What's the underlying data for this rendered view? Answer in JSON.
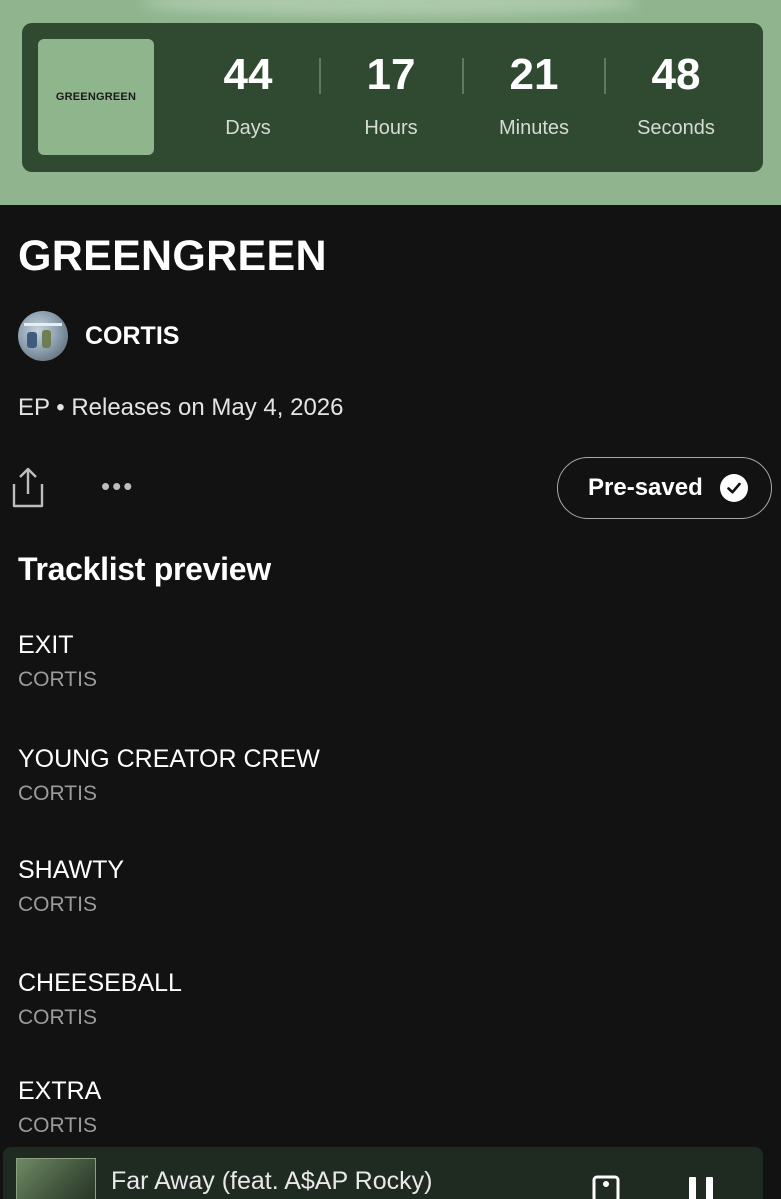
{
  "release": {
    "cover_text": "GREENGREEN",
    "title": "GREENGREEN",
    "artist": "CORTIS",
    "meta": "EP • Releases on May 4, 2026"
  },
  "countdown": {
    "days": {
      "value": "44",
      "label": "Days"
    },
    "hours": {
      "value": "17",
      "label": "Hours"
    },
    "minutes": {
      "value": "21",
      "label": "Minutes"
    },
    "seconds": {
      "value": "48",
      "label": "Seconds"
    }
  },
  "actions": {
    "share_icon": "share-icon",
    "more_label": "•••",
    "presave_label": "Pre-saved",
    "presave_icon": "check-circle-icon"
  },
  "tracklist": {
    "heading": "Tracklist preview",
    "tracks": [
      {
        "title": "EXIT",
        "artist": "CORTIS"
      },
      {
        "title": "YOUNG CREATOR CREW",
        "artist": "CORTIS"
      },
      {
        "title": "SHAWTY",
        "artist": "CORTIS"
      },
      {
        "title": "CHEESEBALL",
        "artist": "CORTIS"
      },
      {
        "title": "EXTRA",
        "artist": "CORTIS"
      }
    ]
  },
  "now_playing": {
    "title": "Far Away (feat. A$AP Rocky)",
    "device_icon": "connect-device-icon",
    "pause_icon": "pause-icon"
  },
  "colors": {
    "header_band": "#8fb48e",
    "countdown_card": "#2f4a30",
    "cover": "#8fb58c",
    "background": "#121212",
    "secondary_text": "#9b9b9b"
  }
}
